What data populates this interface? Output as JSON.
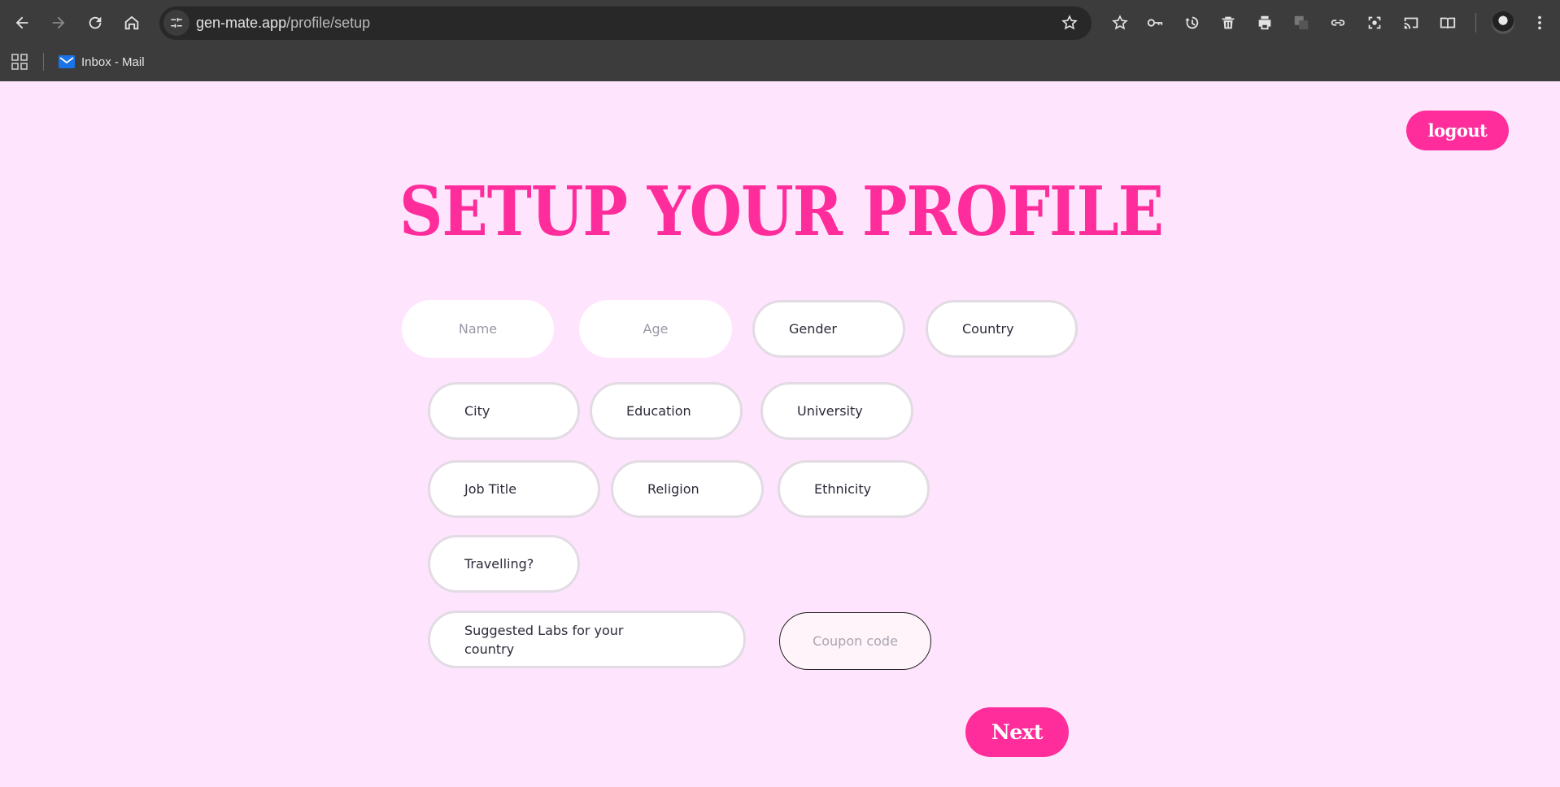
{
  "browser": {
    "url_host": "gen-mate.app",
    "url_path": "/profile/setup",
    "bookmarks": [
      {
        "label": "Inbox - Mail"
      }
    ]
  },
  "page": {
    "logout_label": "logout",
    "title": "SETUP YOUR PROFILE",
    "fields": {
      "name_placeholder": "Name",
      "age_placeholder": "Age",
      "gender": "Gender",
      "country": "Country",
      "city": "City",
      "education": "Education",
      "university": "University",
      "job_title": "Job Title",
      "religion": "Religion",
      "ethnicity": "Ethnicity",
      "travelling": "Travelling?",
      "suggested_labs": "Suggested Labs for your country",
      "coupon_placeholder": "Coupon code"
    },
    "next_label": "Next"
  },
  "colors": {
    "page_background": "#ffe4fe",
    "accent": "#ff2d9b",
    "chrome": "#3c3c3c"
  }
}
